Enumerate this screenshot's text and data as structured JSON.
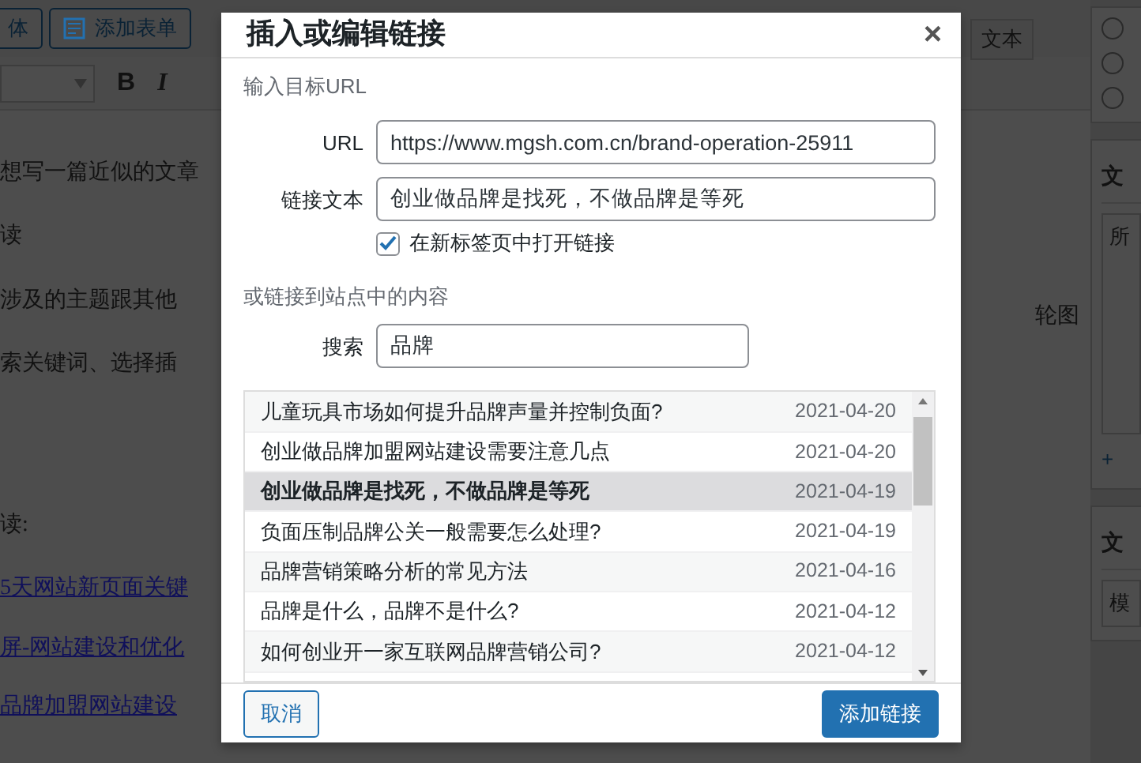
{
  "editor": {
    "media_button": "体",
    "form_button": "添加表单",
    "format_buttons": [
      "B",
      "I"
    ],
    "view_tab": "文本",
    "paragraphs": [
      {
        "kind": "text",
        "text": "想写一篇近似的文章"
      },
      {
        "kind": "text",
        "text": "读"
      },
      {
        "kind": "text",
        "text": "涉及的主题跟其他"
      },
      {
        "kind": "text",
        "text": "索关键词、选择插"
      },
      {
        "kind": "gap",
        "text": "读:"
      },
      {
        "kind": "link",
        "text": "5天网站新页面关键"
      },
      {
        "kind": "link",
        "text": "屏-网站建设和优化"
      },
      {
        "kind": "link",
        "text": "品牌加盟网站建设"
      }
    ],
    "side_text": "轮图"
  },
  "sidebar": {
    "radios": [
      {
        "checked": false
      },
      {
        "checked": false
      },
      {
        "checked": false
      }
    ],
    "panels": [
      {
        "title": "文",
        "body": "所",
        "link": "+"
      },
      {
        "title": "文",
        "body": "模"
      }
    ]
  },
  "dialog": {
    "title": "插入或编辑链接",
    "close": "×",
    "section_url": "输入目标URL",
    "url_label": "URL",
    "url_value": "https://www.mgsh.com.cn/brand-operation-25911",
    "text_label": "链接文本",
    "text_value": "创业做品牌是找死，不做品牌是等死",
    "new_tab": {
      "label": "在新标签页中打开链接",
      "checked": true
    },
    "section_search": "或链接到站点中的内容",
    "search_label": "搜索",
    "search_value": "品牌",
    "results": [
      {
        "title": "儿童玩具市场如何提升品牌声量并控制负面?",
        "date": "2021-04-20",
        "selected": false
      },
      {
        "title": "创业做品牌加盟网站建设需要注意几点",
        "date": "2021-04-20",
        "selected": false
      },
      {
        "title": "创业做品牌是找死，不做品牌是等死",
        "date": "2021-04-19",
        "selected": true
      },
      {
        "title": "负面压制品牌公关一般需要怎么处理?",
        "date": "2021-04-19",
        "selected": false
      },
      {
        "title": "品牌营销策略分析的常见方法",
        "date": "2021-04-16",
        "selected": false
      },
      {
        "title": "品牌是什么，品牌不是什么?",
        "date": "2021-04-12",
        "selected": false
      },
      {
        "title": "如何创业开一家互联网品牌营销公司?",
        "date": "2021-04-12",
        "selected": false
      }
    ],
    "cancel": "取消",
    "submit": "添加链接"
  }
}
